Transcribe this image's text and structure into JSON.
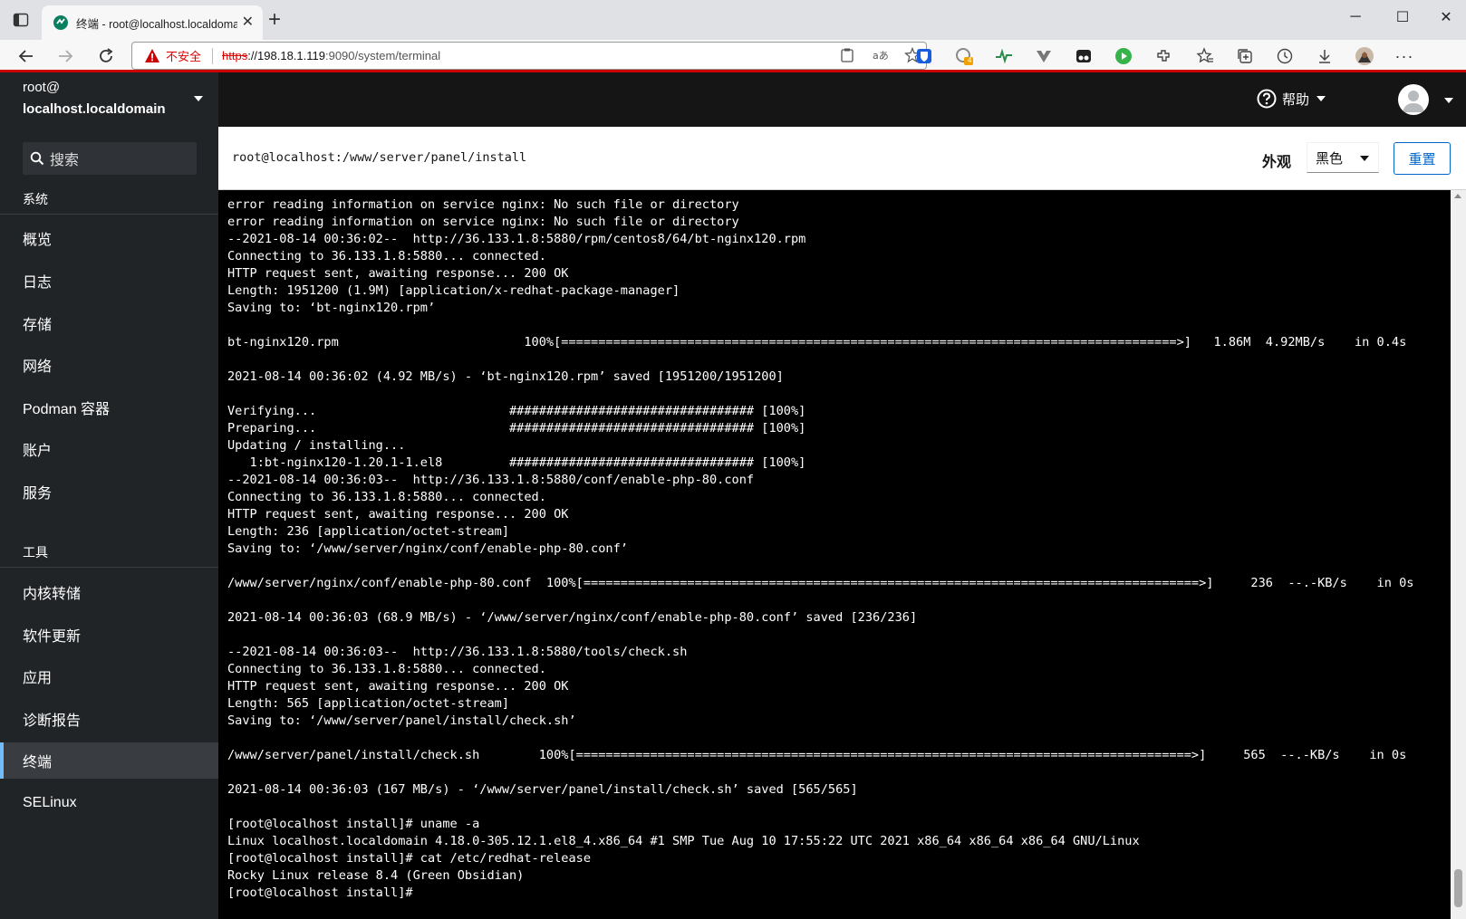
{
  "browser": {
    "tab_title": "终端 - root@localhost.localdomain",
    "insecure_label": "不安全",
    "url_scheme": "https",
    "url_host": "://198.18.1.119",
    "url_rest": ":9090/system/terminal",
    "extension_badge": "4"
  },
  "sidebar": {
    "host_user": "root@",
    "host_name": "localhost.localdomain",
    "search_placeholder": "搜索",
    "section_system": "系统",
    "section_tools": "工具",
    "system_items": [
      "概览",
      "日志",
      "存储",
      "网络",
      "Podman 容器",
      "账户",
      "服务"
    ],
    "tool_items": [
      "内核转储",
      "软件更新",
      "应用",
      "诊断报告",
      "终端",
      "SELinux"
    ],
    "active_item": "终端"
  },
  "masthead": {
    "help_label": "帮助"
  },
  "toolbar": {
    "path": "root@localhost:/www/server/panel/install",
    "appearance_label": "外观",
    "theme_value": "黑色",
    "reset_label": "重置"
  },
  "terminal": {
    "lines": [
      "error reading information on service nginx: No such file or directory",
      "error reading information on service nginx: No such file or directory",
      "--2021-08-14 00:36:02--  http://36.133.1.8:5880/rpm/centos8/64/bt-nginx120.rpm",
      "Connecting to 36.133.1.8:5880... connected.",
      "HTTP request sent, awaiting response... 200 OK",
      "Length: 1951200 (1.9M) [application/x-redhat-package-manager]",
      "Saving to: ‘bt-nginx120.rpm’",
      "",
      "bt-nginx120.rpm                         100%[===================================================================================>]   1.86M  4.92MB/s    in 0.4s",
      "",
      "2021-08-14 00:36:02 (4.92 MB/s) - ‘bt-nginx120.rpm’ saved [1951200/1951200]",
      "",
      "Verifying...                          ################################# [100%]",
      "Preparing...                          ################################# [100%]",
      "Updating / installing...",
      "   1:bt-nginx120-1.20.1-1.el8         ################################# [100%]",
      "--2021-08-14 00:36:03--  http://36.133.1.8:5880/conf/enable-php-80.conf",
      "Connecting to 36.133.1.8:5880... connected.",
      "HTTP request sent, awaiting response... 200 OK",
      "Length: 236 [application/octet-stream]",
      "Saving to: ‘/www/server/nginx/conf/enable-php-80.conf’",
      "",
      "/www/server/nginx/conf/enable-php-80.conf  100%[===================================================================================>]     236  --.-KB/s    in 0s",
      "",
      "2021-08-14 00:36:03 (68.9 MB/s) - ‘/www/server/nginx/conf/enable-php-80.conf’ saved [236/236]",
      "",
      "--2021-08-14 00:36:03--  http://36.133.1.8:5880/tools/check.sh",
      "Connecting to 36.133.1.8:5880... connected.",
      "HTTP request sent, awaiting response... 200 OK",
      "Length: 565 [application/octet-stream]",
      "Saving to: ‘/www/server/panel/install/check.sh’",
      "",
      "/www/server/panel/install/check.sh        100%[===================================================================================>]     565  --.-KB/s    in 0s",
      "",
      "2021-08-14 00:36:03 (167 MB/s) - ‘/www/server/panel/install/check.sh’ saved [565/565]",
      "",
      "[root@localhost install]# uname -a",
      "Linux localhost.localdomain 4.18.0-305.12.1.el8_4.x86_64 #1 SMP Tue Aug 10 17:55:22 UTC 2021 x86_64 x86_64 x86_64 GNU/Linux",
      "[root@localhost install]# cat /etc/redhat-release",
      "Rocky Linux release 8.4 (Green Obsidian)",
      "[root@localhost install]#"
    ]
  },
  "colors": {
    "sidebar_bg": "#212427",
    "masthead_bg": "#151515",
    "accent": "#0066cc",
    "active_border": "#73bcf7",
    "terminal_bg": "#000000",
    "terminal_fg": "#ffffff"
  }
}
